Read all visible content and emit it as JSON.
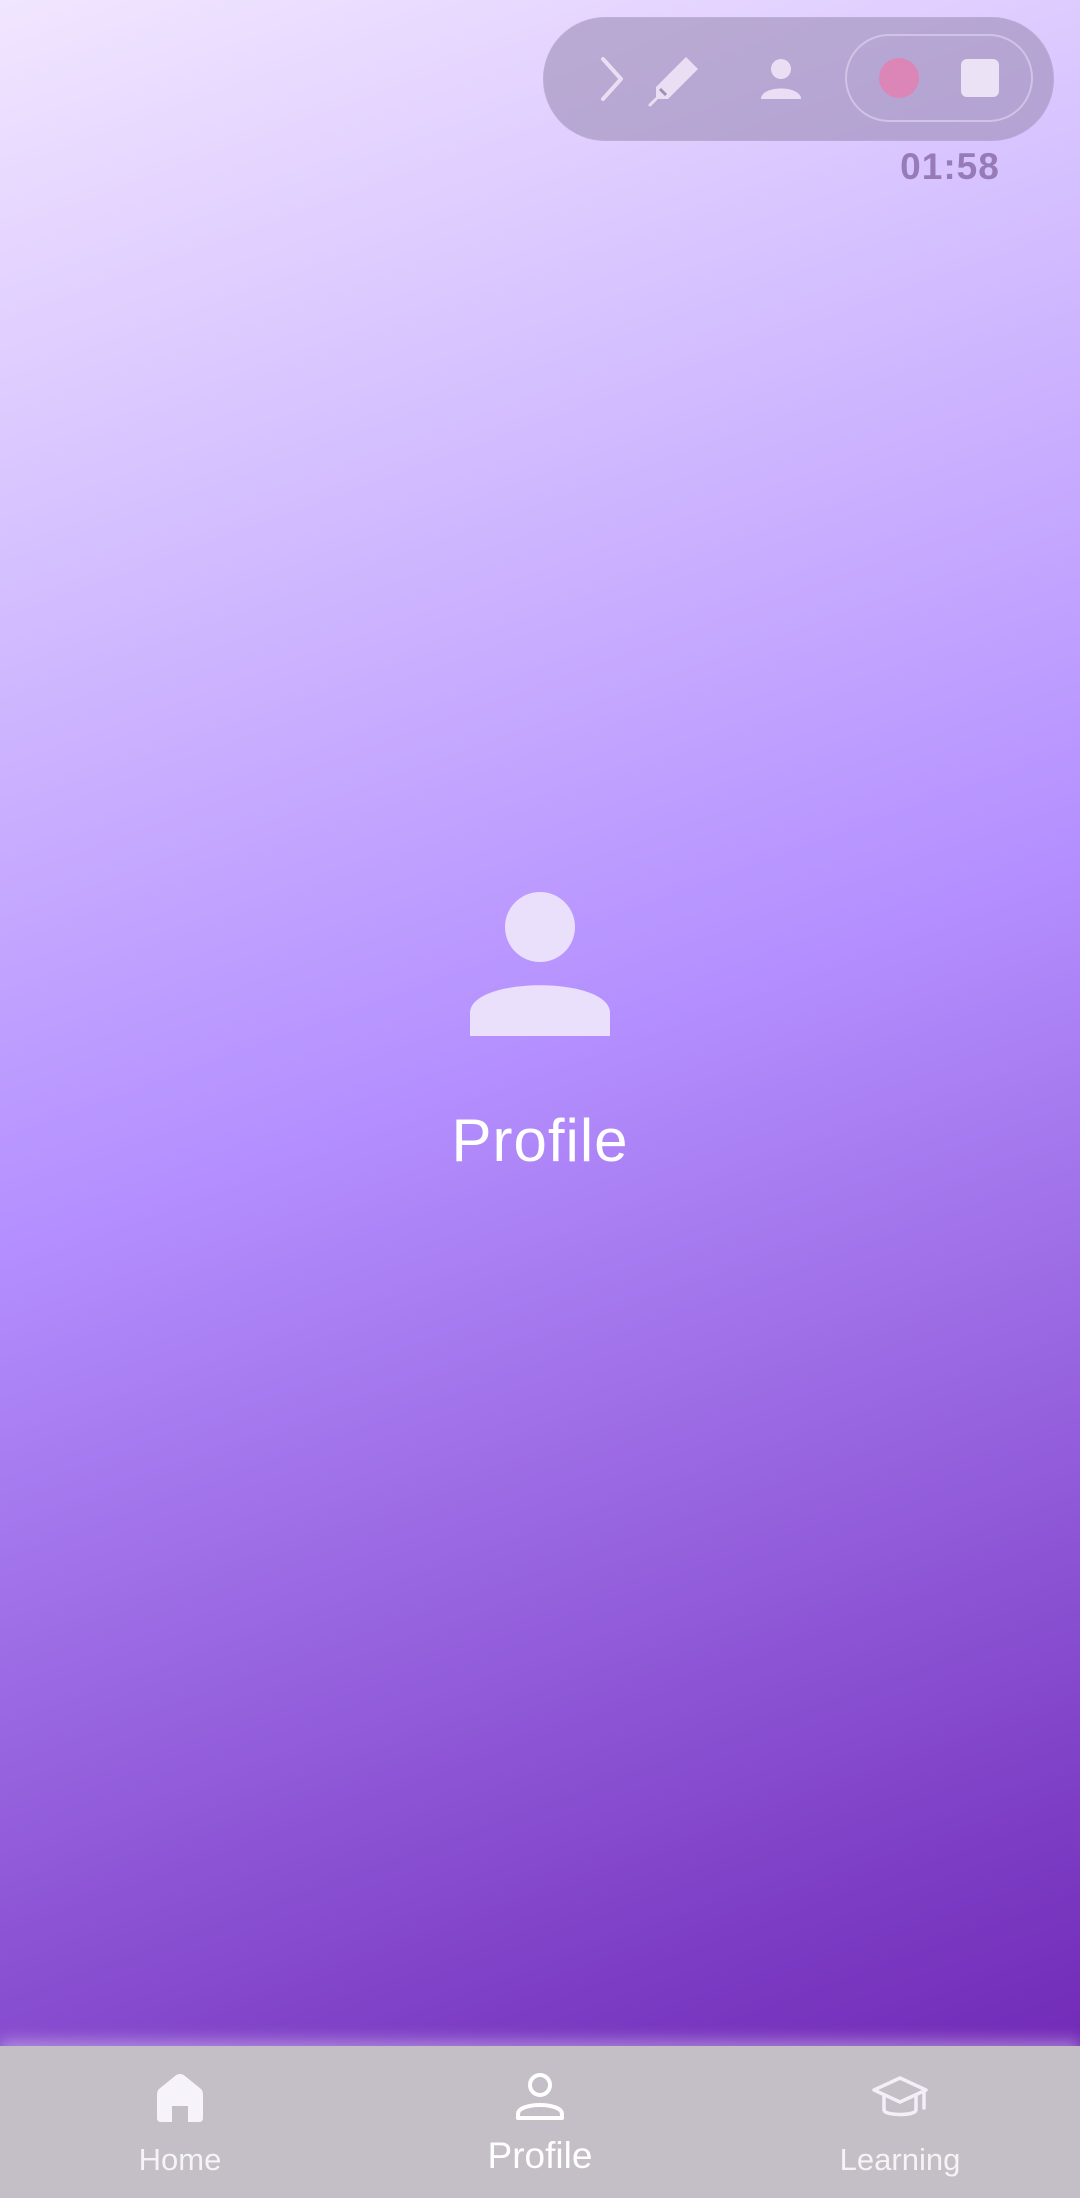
{
  "recorder": {
    "icons": [
      "chevron-right-icon",
      "pencil-icon",
      "person-icon"
    ],
    "record_color": "#dc86b8",
    "time": "01:58"
  },
  "main": {
    "icon": "person-icon",
    "title": "Profile"
  },
  "bottom_nav": {
    "items": [
      {
        "label": "Home",
        "icon": "home-icon",
        "active": false
      },
      {
        "label": "Profile",
        "icon": "person-outline-icon",
        "active": true
      },
      {
        "label": "Learning",
        "icon": "graduation-cap-icon",
        "active": false
      }
    ]
  },
  "colors": {
    "gradient_top": "#f1e6ff",
    "gradient_mid": "#b48fff",
    "gradient_bottom": "#6c1fae",
    "nav_background": "#c4bec6"
  }
}
